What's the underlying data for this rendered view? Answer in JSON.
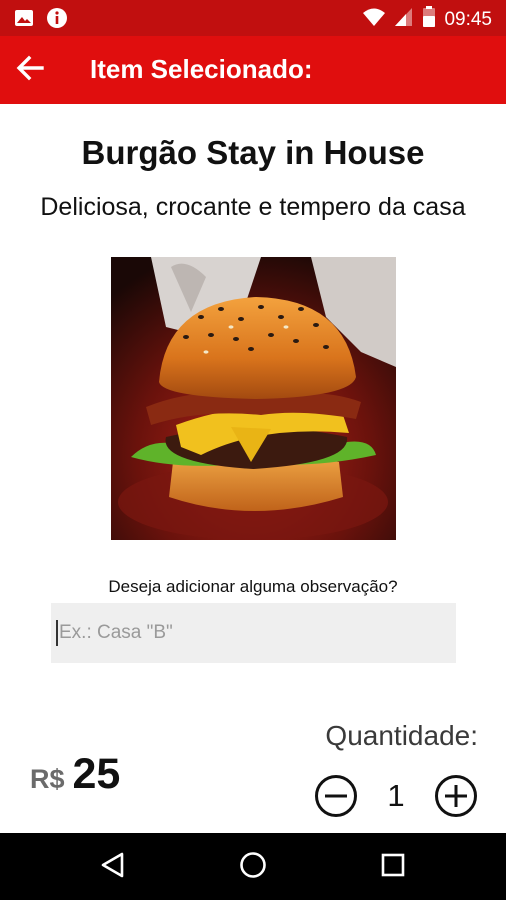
{
  "status_bar": {
    "time": "09:45",
    "icons": [
      "image-icon",
      "info-icon",
      "wifi-icon",
      "signal-icon",
      "battery-icon"
    ]
  },
  "app_bar": {
    "title": "Item Selecionado:",
    "back_icon": "arrow-back-icon"
  },
  "product": {
    "name": "Burgão Stay in House",
    "description": "Deliciosa, crocante e tempero da casa",
    "image_icon": "burger-photo"
  },
  "observation": {
    "label": "Deseja adicionar alguma observação?",
    "placeholder": "Ex.: Casa \"B\"",
    "value": ""
  },
  "price": {
    "currency": "R$",
    "value": "25"
  },
  "quantity": {
    "label": "Quantidade:",
    "value": "1"
  },
  "colors": {
    "status_bar": "#c10f0f",
    "app_bar": "#e00e0e",
    "input_bg": "#efefef"
  },
  "nav_bar": {
    "icons": [
      "nav-back-icon",
      "nav-home-icon",
      "nav-recent-icon"
    ]
  }
}
